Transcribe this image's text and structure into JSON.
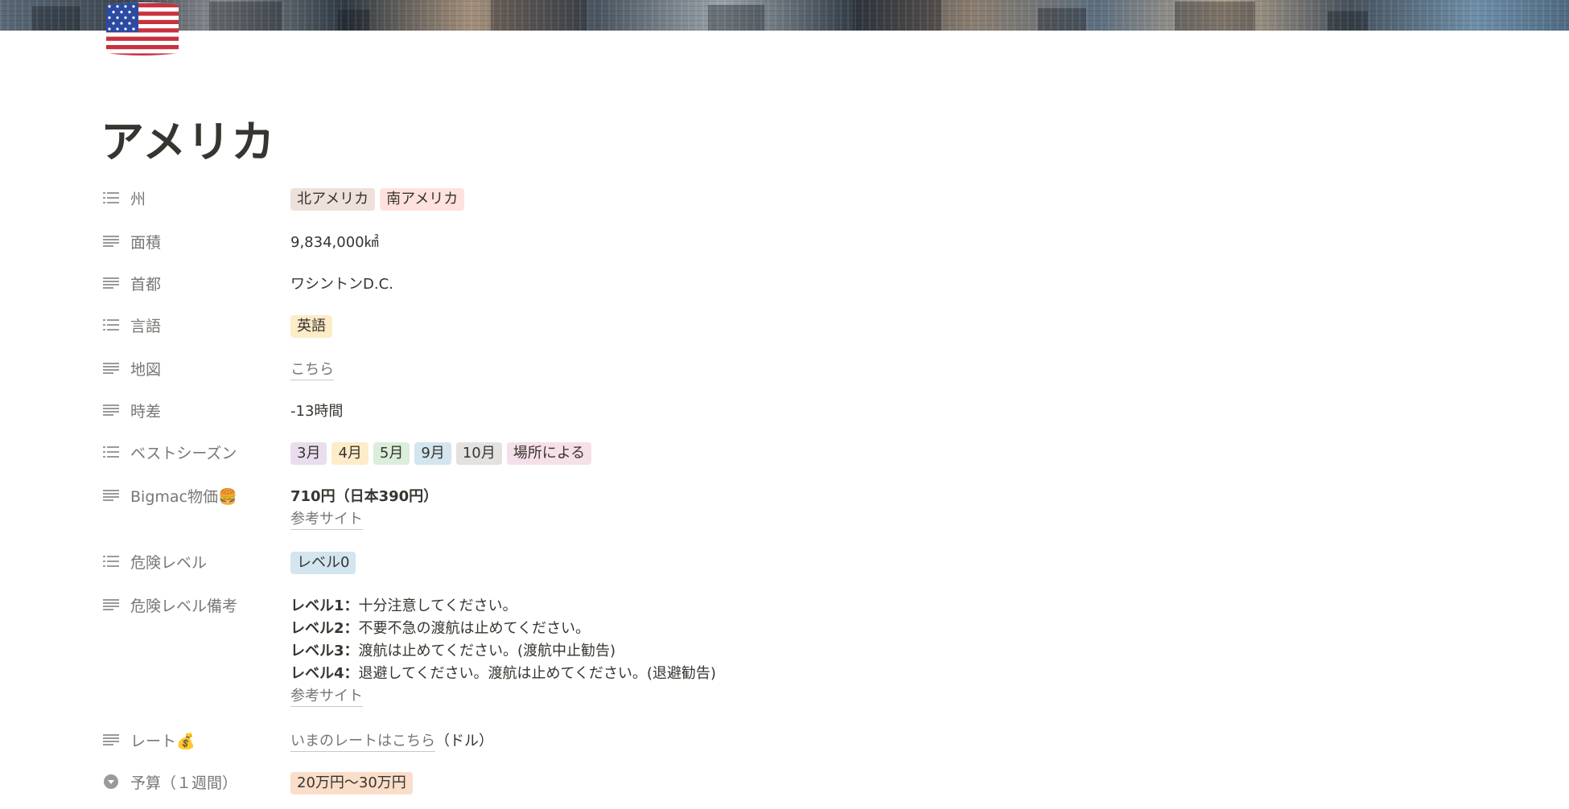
{
  "page": {
    "icon": "us-flag-icon",
    "title": "アメリカ"
  },
  "colors": {
    "tag_brown": "#eee0da",
    "tag_red": "#ffe2dd",
    "tag_yellow": "#fdecc8",
    "tag_purple": "#e8deee",
    "tag_green": "#dbeddb",
    "tag_blue": "#d3e5ef",
    "tag_gray": "#e3e2e0",
    "tag_pink": "#f5e0e9",
    "tag_orange": "#fadec9"
  },
  "properties": {
    "state": {
      "label": "州",
      "icon": "multi-select-icon",
      "tags": [
        "北アメリカ",
        "南アメリカ"
      ]
    },
    "area": {
      "label": "面積",
      "icon": "text-icon",
      "value": "9,834,000㎢"
    },
    "capital": {
      "label": "首都",
      "icon": "text-icon",
      "value": "ワシントンD.C."
    },
    "language": {
      "label": "言語",
      "icon": "multi-select-icon",
      "tags": [
        "英語"
      ]
    },
    "map": {
      "label": "地図",
      "icon": "text-icon",
      "link": "こちら"
    },
    "time_diff": {
      "label": "時差",
      "icon": "text-icon",
      "value": "-13時間"
    },
    "best_season": {
      "label": "ベストシーズン",
      "icon": "multi-select-icon",
      "tags": [
        "3月",
        "4月",
        "5月",
        "9月",
        "10月",
        "場所による"
      ]
    },
    "bigmac": {
      "label": "Bigmac物価🍔",
      "icon": "text-icon",
      "value": "710円（日本390円）",
      "link": "参考サイト"
    },
    "danger_level": {
      "label": "危険レベル",
      "icon": "multi-select-icon",
      "tags": [
        "レベル0"
      ]
    },
    "danger_note": {
      "label": "危険レベル備考",
      "icon": "text-icon",
      "lines": [
        {
          "head": "レベル1：",
          "text": "十分注意してください。"
        },
        {
          "head": "レベル2：",
          "text": "不要不急の渡航は止めてください。"
        },
        {
          "head": "レベル3：",
          "text": "渡航は止めてください。(渡航中止勧告)"
        },
        {
          "head": "レベル4：",
          "text": "退避してください。渡航は止めてください。(退避勧告)"
        }
      ],
      "link": "参考サイト"
    },
    "rate": {
      "label": "レート💰",
      "icon": "text-icon",
      "link": "いまのレートはこちら",
      "suffix": "（ドル）"
    },
    "budget": {
      "label": "予算（１週間）",
      "icon": "select-icon",
      "tags": [
        "20万円〜30万円"
      ]
    }
  }
}
